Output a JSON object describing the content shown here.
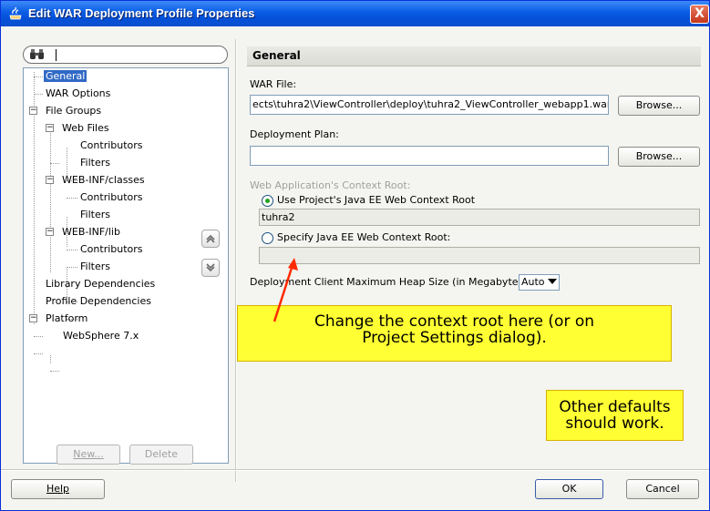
{
  "window": {
    "title": "Edit WAR Deployment Profile Properties",
    "close_glyph": "X"
  },
  "search": {
    "placeholder": ""
  },
  "tree": {
    "items": [
      {
        "label": "General",
        "selected": true
      },
      {
        "label": "WAR Options"
      },
      {
        "label": "File Groups",
        "expander": "−"
      },
      {
        "label": "Web Files",
        "expander": "−"
      },
      {
        "label": "Contributors"
      },
      {
        "label": "Filters"
      },
      {
        "label": "WEB-INF/classes",
        "expander": "−"
      },
      {
        "label": "Contributors"
      },
      {
        "label": "Filters"
      },
      {
        "label": "WEB-INF/lib",
        "expander": "−"
      },
      {
        "label": "Contributors"
      },
      {
        "label": "Filters"
      },
      {
        "label": "Library Dependencies"
      },
      {
        "label": "Profile Dependencies"
      },
      {
        "label": "Platform",
        "expander": "−"
      },
      {
        "label": "WebSphere 7.x"
      }
    ],
    "new_button": "New...",
    "delete_button": "Delete"
  },
  "general": {
    "header": "General",
    "war_file_label": "WAR File:",
    "war_file_value": "ects\\tuhra2\\ViewController\\deploy\\tuhra2_ViewController_webapp1.war",
    "browse_label": "Browse...",
    "deployment_plan_label": "Deployment Plan:",
    "deployment_plan_value": "",
    "context_root_label": "Web Application's Context Root:",
    "use_project_root_label": "Use Project's Java EE Web Context Root",
    "project_root_value": "tuhra2",
    "specify_root_label": "Specify Java EE Web Context Root:",
    "specify_root_value": "",
    "heap_label": "Deployment Client Maximum Heap Size (in Megabytes):",
    "heap_value": "Auto"
  },
  "annotations": {
    "context_note_line1": "Change the context root here (or on",
    "context_note_line2": "Project Settings dialog).",
    "defaults_note_line1": "Other defaults",
    "defaults_note_line2": "should work."
  },
  "footer": {
    "help_button": "Help",
    "ok_button": "OK",
    "cancel_button": "Cancel"
  },
  "colors": {
    "titlebar": "#0a5ce4",
    "selection": "#316ac5",
    "note_fill": "#ffff33",
    "arrow": "#ff2a00"
  }
}
